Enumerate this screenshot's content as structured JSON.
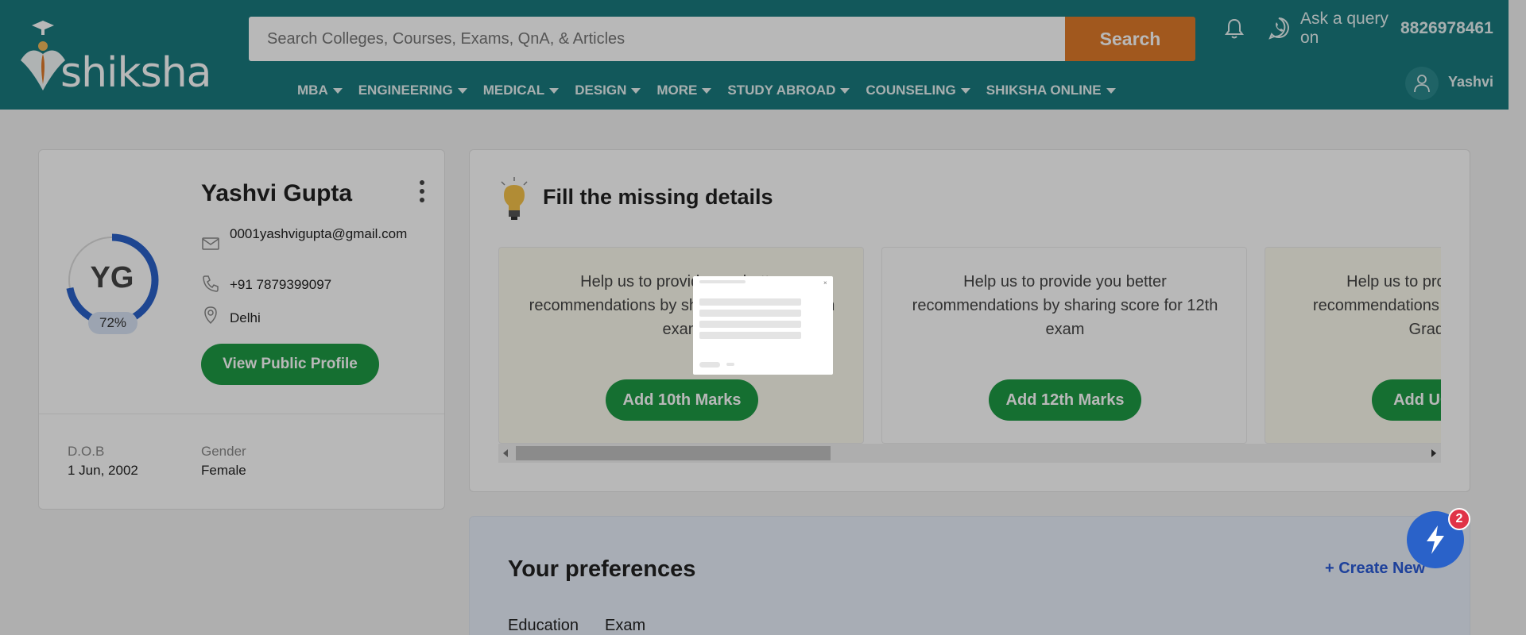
{
  "header": {
    "logo_text": "shiksha",
    "search_placeholder": "Search Colleges, Courses, Exams, QnA, & Articles",
    "search_button": "Search",
    "ask_query": "Ask a query on",
    "phone": "8826978461",
    "user_name": "Yashvi",
    "brand_color": "#1a7a7f",
    "search_button_color": "#e07b2a",
    "nav": [
      "MBA",
      "ENGINEERING",
      "MEDICAL",
      "DESIGN",
      "MORE",
      "STUDY ABROAD",
      "COUNSELING",
      "SHIKSHA ONLINE"
    ]
  },
  "profile": {
    "initials": "YG",
    "completion": "72%",
    "completion_fraction": 0.72,
    "name": "Yashvi Gupta",
    "email": "0001yashvigupta@gmail.com",
    "phone": "+91 7879399097",
    "location": "Delhi",
    "view_button": "View Public Profile",
    "dob_label": "D.O.B",
    "dob_value": "1 Jun, 2002",
    "gender_label": "Gender",
    "gender_value": "Female"
  },
  "missing": {
    "title": "Fill the missing details",
    "cards": [
      {
        "text": "Help us to provide you better recommendations by sharing score for 10th exam",
        "button": "Add 10th Marks"
      },
      {
        "text": "Help us to provide you better recommendations by sharing score for 12th exam",
        "button": "Add 12th Marks"
      },
      {
        "text": "Help us to provide you better recommendations by sharing score for Graduation",
        "button": "Add UG Marks"
      }
    ]
  },
  "preferences": {
    "title": "Your preferences",
    "create_new": "+ Create New",
    "labels": [
      "Education",
      "Exam"
    ]
  },
  "fab": {
    "badge": "2",
    "color": "#2a62c9"
  }
}
